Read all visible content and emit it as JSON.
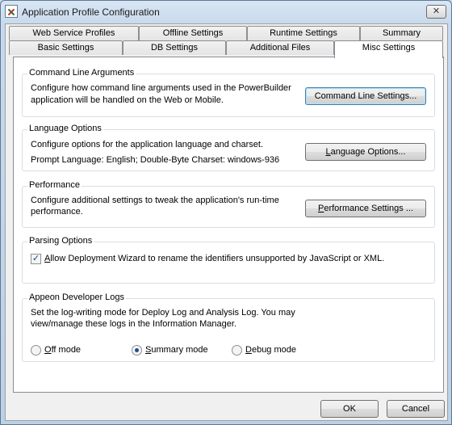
{
  "window": {
    "title": "Application Profile Configuration",
    "close_glyph": "✕"
  },
  "tabs": {
    "row1": [
      "Web Service Profiles",
      "Offline Settings",
      "Runtime Settings",
      "Summary"
    ],
    "row2": [
      "Basic Settings",
      "DB Settings",
      "Additional Files",
      "Misc Settings"
    ],
    "active": "Misc Settings"
  },
  "groups": {
    "command_line": {
      "title": "Command Line Arguments",
      "desc_line1": "Configure how command line arguments used in the PowerBuilder",
      "desc_line2": "application will be handled on the Web or Mobile.",
      "button": "Command Line Settings..."
    },
    "language": {
      "title": "Language Options",
      "desc_line1": "Configure options for the application language and charset.",
      "desc_line2": "Prompt Language: English; Double-Byte Charset: windows-936",
      "button_pre": "",
      "button_key": "L",
      "button_post": "anguage Options..."
    },
    "performance": {
      "title": "Performance",
      "desc_line1": "Configure additional settings to tweak the application's run-time",
      "desc_line2": "performance.",
      "button_key": "P",
      "button_post": "erformance Settings ..."
    },
    "parsing": {
      "title": "Parsing Options",
      "checkbox_key": "A",
      "checkbox_post": "llow Deployment Wizard to rename the identifiers unsupported by JavaScript or XML.",
      "checked": true
    },
    "logs": {
      "title": "Appeon Developer Logs",
      "desc_line1": "Set the log-writing mode for Deploy Log and Analysis Log.  You may",
      "desc_line2": "view/manage these logs in the Information Manager.",
      "options": [
        {
          "key": "O",
          "rest": "ff mode",
          "checked": false
        },
        {
          "key": "S",
          "rest": "ummary mode",
          "checked": true
        },
        {
          "key": "D",
          "rest": "ebug mode",
          "checked": false
        }
      ]
    }
  },
  "footer": {
    "ok": "OK",
    "cancel": "Cancel"
  },
  "colors": {
    "default_button_border": "#3c7fb1",
    "panel_bg": "#ffffff",
    "dialog_bg": "#f0f0f0"
  }
}
